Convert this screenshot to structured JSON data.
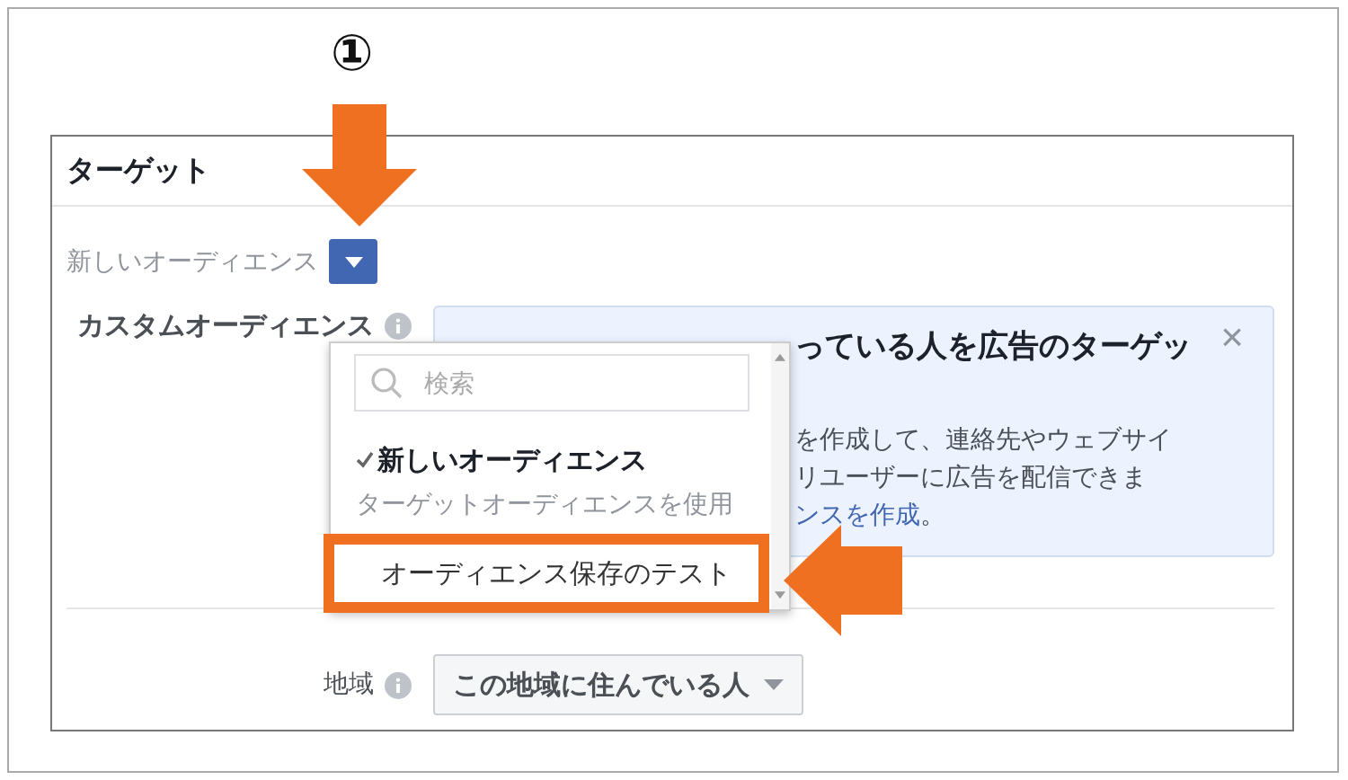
{
  "annotation": {
    "step_number": "①"
  },
  "panel": {
    "title": "ターゲット",
    "audience_label": "新しいオーディエンス",
    "custom_audience_label": "カスタムオーディエンス",
    "info_box": {
      "lines": [
        "っている人を広告のターゲッ",
        "を作成して、連絡先やウェブサイ",
        "リユーザーに広告を配信できま"
      ],
      "link": "ンスを作成",
      "link_suffix": "。",
      "close": "×"
    },
    "location_label": "地域",
    "location_select": "この地域に住んでいる人"
  },
  "dropdown": {
    "search": {
      "placeholder": "検索"
    },
    "items": [
      {
        "kind": "option",
        "label": "新しいオーディエンス",
        "checked": true,
        "highlighted": false
      },
      {
        "kind": "header",
        "label": "ターゲットオーディエンスを使用"
      },
      {
        "kind": "option",
        "label": "オーディエンス保存のテスト",
        "checked": false,
        "highlighted": true
      }
    ]
  }
}
